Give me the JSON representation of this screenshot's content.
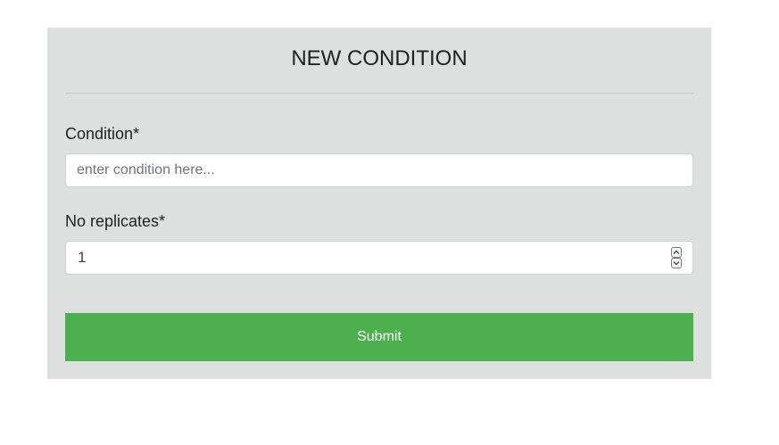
{
  "form": {
    "title": "NEW CONDITION",
    "condition": {
      "label": "Condition*",
      "placeholder": "enter condition here...",
      "value": ""
    },
    "replicates": {
      "label": "No replicates*",
      "value": "1",
      "increment_icon": "chevron-up-icon",
      "decrement_icon": "chevron-down-icon"
    },
    "submit_label": "Submit"
  },
  "colors": {
    "panel_background": "#dedfdf",
    "submit_background": "#4caf50",
    "submit_text": "#ffffff"
  }
}
